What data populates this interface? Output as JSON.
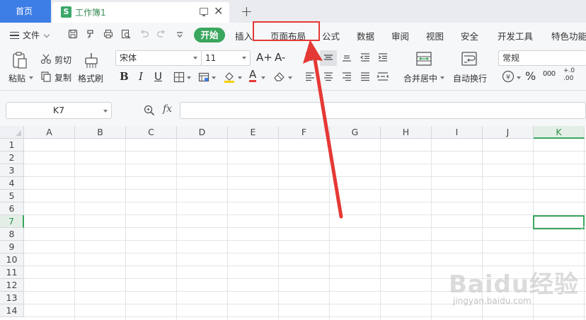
{
  "tabbar": {
    "home_tab": "首页",
    "doc_icon_letter": "S",
    "doc_title": "工作簿1",
    "close_glyph": "✕",
    "new_tab_glyph": "+"
  },
  "menu": {
    "file_label": "文件",
    "tabs": [
      {
        "label": "开始",
        "active": true
      },
      {
        "label": "插入"
      },
      {
        "label": "页面布局",
        "highlighted": true
      },
      {
        "label": "公式"
      },
      {
        "label": "数据"
      },
      {
        "label": "审阅"
      },
      {
        "label": "视图"
      },
      {
        "label": "安全"
      },
      {
        "label": "开发工具"
      },
      {
        "label": "特色功能"
      }
    ],
    "quick_access_icons": [
      "save-icon",
      "format-painter-icon",
      "print-icon",
      "print-preview-icon",
      "undo-icon",
      "redo-icon",
      "customize-icon"
    ]
  },
  "ribbon": {
    "paste_label": "粘贴",
    "cut_label": "剪切",
    "copy_label": "复制",
    "format_painter_label": "格式刷",
    "font_name": "宋体",
    "font_size": "11",
    "grow_font_glyph": "A+",
    "shrink_font_glyph": "A-",
    "bold_glyph": "B",
    "italic_glyph": "I",
    "underline_glyph": "U",
    "font_color_glyph": "A",
    "merge_label": "合并居中",
    "wrap_label": "自动换行",
    "number_format": "常规",
    "percent_glyph": "%",
    "thousands_glyph": "000",
    "currency_glyph": "¥",
    "inc_decimal_glyph": "+.0",
    "dec_decimal_glyph": ".00",
    "colors": {
      "font_color": "#e53935",
      "fill_color": "#f5d100"
    }
  },
  "formula_bar": {
    "name_box": "K7",
    "fx_label": "fx",
    "formula_value": ""
  },
  "grid": {
    "columns": [
      "A",
      "B",
      "C",
      "D",
      "E",
      "F",
      "G",
      "H",
      "I",
      "J",
      "K"
    ],
    "rows": [
      "1",
      "2",
      "3",
      "4",
      "5",
      "6",
      "7",
      "8",
      "9",
      "10",
      "11",
      "12",
      "13",
      "14"
    ],
    "selected_column": "K",
    "selected_row": "7"
  },
  "annotation": {
    "highlight_color": "#e53935",
    "target": "页面布局"
  },
  "watermark": {
    "main_text": "Baidu经验",
    "sub_text": "jingyan.baidu.com"
  }
}
